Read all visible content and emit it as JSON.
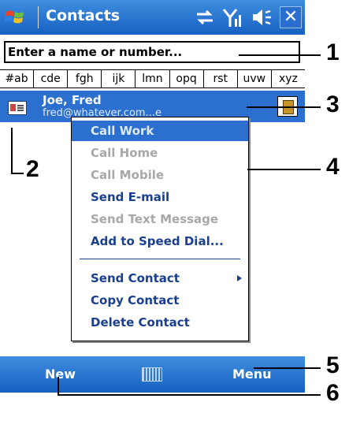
{
  "titlebar": {
    "title": "Contacts",
    "close_label": "✕"
  },
  "search": {
    "placeholder": "Enter a name or number..."
  },
  "alphabet_tabs": [
    "#ab",
    "cde",
    "fgh",
    "ijk",
    "lmn",
    "opq",
    "rst",
    "uvw",
    "xyz"
  ],
  "contact": {
    "name": "Joe, Fred",
    "email": "fred@whatever.com...e"
  },
  "menu": {
    "items": [
      {
        "label": "Call Work",
        "state": "selected"
      },
      {
        "label": "Call Home",
        "state": "disabled"
      },
      {
        "label": "Call Mobile",
        "state": "disabled"
      },
      {
        "label": "Send E-mail",
        "state": "enabled"
      },
      {
        "label": "Send Text Message",
        "state": "disabled"
      },
      {
        "label": "Add to Speed Dial...",
        "state": "enabled"
      },
      {
        "label": "Send Contact",
        "state": "enabled",
        "submenu": true
      },
      {
        "label": "Copy Contact",
        "state": "enabled"
      },
      {
        "label": "Delete Contact",
        "state": "enabled"
      }
    ]
  },
  "softkeys": {
    "left": "New",
    "right": "Menu"
  },
  "callouts": [
    "1",
    "2",
    "3",
    "4",
    "5",
    "6"
  ],
  "colors": {
    "titlebar": "#2b6fcf",
    "selection": "#2b6fcf",
    "enabled_text": "#1a3f8f",
    "disabled_text": "#a8a8a8"
  }
}
